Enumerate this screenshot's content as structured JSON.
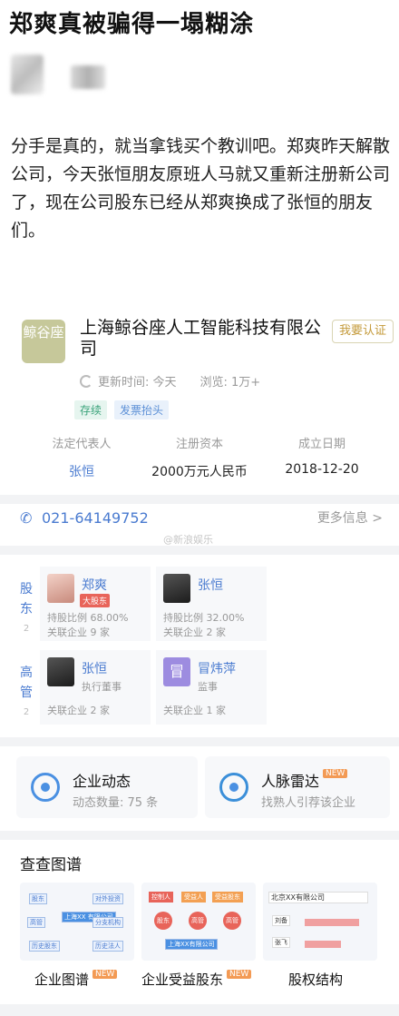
{
  "post": {
    "headline": "郑爽真被骗得一塌糊涂",
    "body": "分手是真的，就当拿钱买个教训吧。郑爽昨天解散公司，今天张恒朋友原班人马就又重新注册新公司了，现在公司股东已经从郑爽换成了张恒的朋友们。"
  },
  "company": {
    "logo_text": "鲸谷座",
    "name": "上海鲸谷座人工智能科技有限公司",
    "claim_label": "我要认证",
    "update_time": "更新时间: 今天",
    "views": "浏览: 1万+",
    "tags": [
      "存续",
      "发票抬头"
    ],
    "info_labels": [
      "法定代表人",
      "注册资本",
      "成立日期"
    ],
    "legal_rep": "张恒",
    "registered_capital": "2000万元人民币",
    "established": "2018-12-20",
    "phone": "021-64149752",
    "more_info": "更多信息 >",
    "watermark": "@新浪娱乐"
  },
  "shareholders": {
    "side_label": "股东",
    "count": "2",
    "items": [
      {
        "name": "郑爽",
        "badge": "大股东",
        "ratio": "持股比例 68.00%",
        "related": "关联企业 9 家"
      },
      {
        "name": "张恒",
        "badge": "",
        "ratio": "持股比例 32.00%",
        "related": "关联企业 2 家"
      }
    ]
  },
  "executives": {
    "side_label": "高管",
    "count": "2",
    "items": [
      {
        "name": "张恒",
        "role": "执行董事",
        "related": "关联企业 2 家",
        "avatar": ""
      },
      {
        "name": "冒炜萍",
        "role": "监事",
        "related": "关联企业 1 家",
        "avatar": "冒"
      }
    ]
  },
  "dynamics": [
    {
      "title": "企业动态",
      "subtitle": "动态数量: 75 条",
      "badge": ""
    },
    {
      "title": "人脉雷达",
      "subtitle": "找熟人引荐该企业",
      "badge": "NEW"
    }
  ],
  "graph_section": {
    "title": "查查图谱",
    "items": [
      {
        "label": "企业图谱",
        "badge": "NEW"
      },
      {
        "label": "企业受益股东",
        "badge": "NEW"
      },
      {
        "label": "股权结构",
        "badge": ""
      }
    ],
    "thumb1_nodes": [
      "股东",
      "对外投资",
      "高管",
      "分支机构",
      "历史股东",
      "历史法人",
      "上海XX 有限公司"
    ],
    "thumb2_nodes": [
      "控制人",
      "受益人",
      "受益股东",
      "股东",
      "高管",
      "高管",
      "上海XX有限公司"
    ],
    "thumb3_nodes": [
      "北京XX有限公司",
      "刘备",
      "张飞"
    ]
  },
  "colors": {
    "accent": "#4a7bd0",
    "brand_logo": "#c6c89a",
    "badge_red": "#e8645a",
    "new_orange": "#f39a54"
  }
}
